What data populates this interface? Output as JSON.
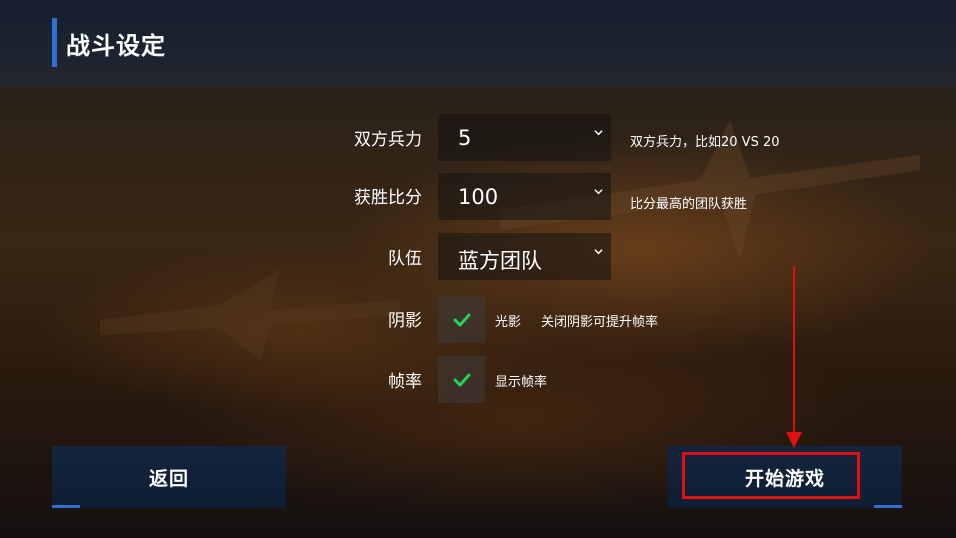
{
  "header": {
    "title": "战斗设定"
  },
  "settings": {
    "forces": {
      "label": "双方兵力",
      "value": "5",
      "hint": "双方兵力，比如20 VS 20"
    },
    "win_score": {
      "label": "获胜比分",
      "value": "100",
      "hint": "比分最高的团队获胜"
    },
    "team": {
      "label": "队伍",
      "value": "蓝方团队"
    },
    "shadow": {
      "label": "阴影",
      "checked": true,
      "option_label": "光影",
      "hint": "关闭阴影可提升帧率"
    },
    "framerate": {
      "label": "帧率",
      "checked": true,
      "option_label": "显示帧率"
    }
  },
  "buttons": {
    "back": "返回",
    "start": "开始游戏"
  },
  "colors": {
    "accent": "#2f6fd0",
    "check": "#22d45a",
    "annotation": "#e01010"
  }
}
